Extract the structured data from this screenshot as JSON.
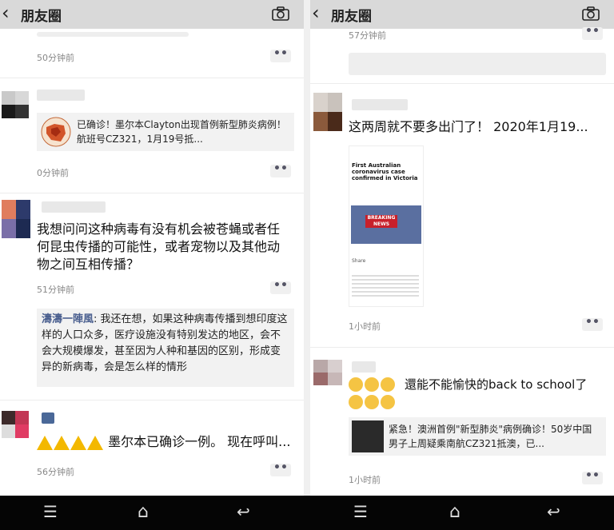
{
  "app": {
    "title": "朋友圈"
  },
  "left": {
    "top_time": "50分钟前",
    "posts": [
      {
        "card_text": "已确诊！墨尔本Clayton出现首例新型肺炎病例！航班号CZ321，1月19号抵...",
        "time": "0分钟前"
      },
      {
        "text": "我想问问这种病毒有没有机会被苍蝇或者任何昆虫传播的可能性，或者宠物以及其他动物之间互相传播？",
        "time": "51分钟前",
        "comment_name": "濤濤一陣風",
        "comment_text": ": 我还在想，如果这种病毒传播到想印度这样的人口众多，医疗设施没有特别发达的地区，会不会大规模爆发，甚至因为人种和基因的区别，形成变异的新病毒，会是怎么样的情形"
      },
      {
        "text": "墨尔本已确诊一例。 现在呼叫...",
        "time": "56分钟前"
      }
    ]
  },
  "right": {
    "top_time": "57分钟前",
    "posts": [
      {
        "text": "这两周就不要多出门了！ 2020年1月19...",
        "article_headline": "First Australian coronavirus case confirmed in Victoria",
        "article_banner": "BREAKING NEWS",
        "article_share": "Share",
        "time": "1小时前"
      },
      {
        "text": "還能不能愉快的back to school了",
        "card_text": "紧急！澳洲首例\"新型肺炎\"病例确诊！50岁中国男子上周疑乘南航CZ321抵澳，已...",
        "time": "1小时前"
      }
    ]
  },
  "more_label": "••",
  "system_nav": {
    "menu": "☰",
    "home": "⌂",
    "back": "↩"
  },
  "colors": {
    "navbar": "#d9d9d9",
    "link": "#4a5f8f",
    "card": "#f2f2f2",
    "warning": "#f3b800"
  }
}
